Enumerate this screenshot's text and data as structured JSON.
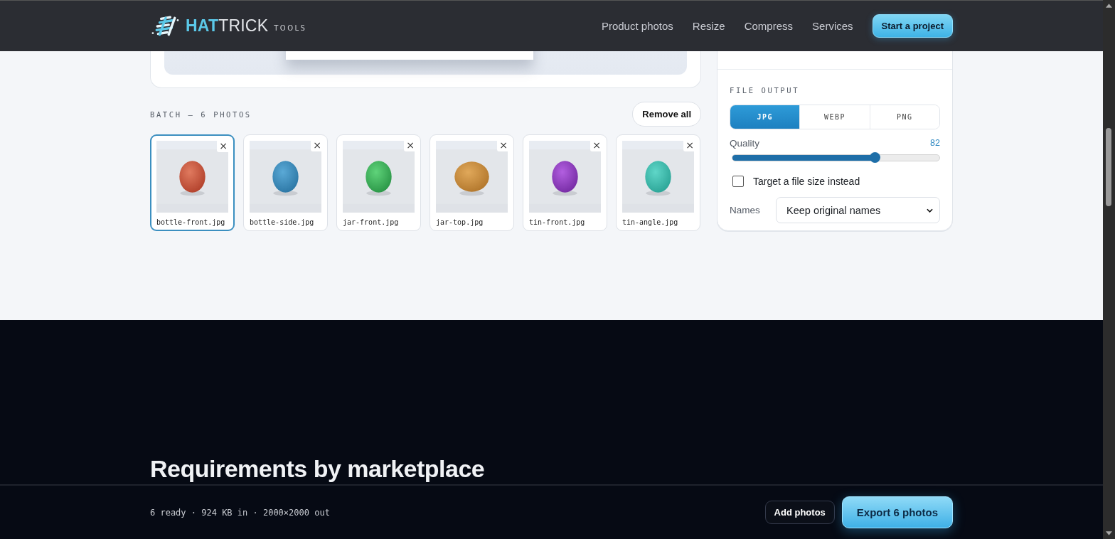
{
  "header": {
    "brand": "**HAT**TRICK",
    "brand_sub": "TOOLS",
    "nav": [
      "Product photos",
      "Resize",
      "Compress",
      "Services"
    ],
    "cta": "Start a project"
  },
  "batch": {
    "title": "BATCH — 6 PHOTOS",
    "remove_all": "Remove all",
    "photos": [
      {
        "name": "bottle-front.jpg",
        "selected": true,
        "remove": "×"
      },
      {
        "name": "bottle-side.jpg",
        "selected": false,
        "remove": "×"
      },
      {
        "name": "jar-front.jpg",
        "selected": false,
        "remove": "×"
      },
      {
        "name": "jar-top.jpg",
        "selected": false,
        "remove": "×"
      },
      {
        "name": "tin-front.jpg",
        "selected": false,
        "remove": "×"
      },
      {
        "name": "tin-angle.jpg",
        "selected": false,
        "remove": "×"
      }
    ]
  },
  "settings": {
    "file_output": {
      "title": "FILE OUTPUT",
      "formats": [
        {
          "label": "JPG",
          "selected": true
        },
        {
          "label": "WEBP",
          "selected": false
        },
        {
          "label": "PNG",
          "selected": false
        }
      ]
    },
    "quality": {
      "label": "Quality",
      "reading": "82",
      "level": 0.69
    },
    "target_size": {
      "label": "Target a file size instead",
      "checked": false
    },
    "names": {
      "label": "Names",
      "value": "Keep original names"
    }
  },
  "section": {
    "heading": "Requirements by marketplace"
  },
  "footer_bar": {
    "status": "6 ready · 924 KB in · 2000×2000 out",
    "add": "Add photos",
    "export": "Export 6 photos"
  }
}
